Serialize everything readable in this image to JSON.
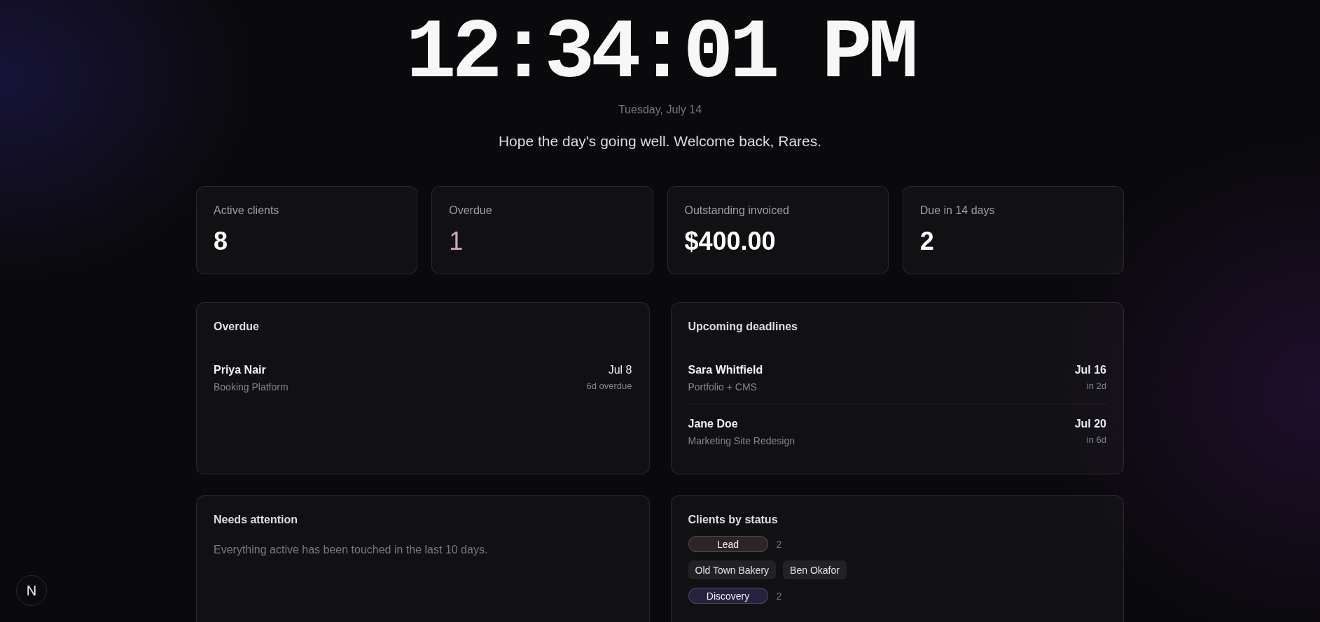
{
  "clock": {
    "time": "12:34:01 PM",
    "date": "Tuesday, July 14",
    "greeting": "Hope the day's going well. Welcome back, Rares."
  },
  "stats": [
    {
      "label": "Active clients",
      "value": "8",
      "alert": false
    },
    {
      "label": "Overdue",
      "value": "1",
      "alert": true
    },
    {
      "label": "Outstanding invoiced",
      "value": "$400.00",
      "alert": false
    },
    {
      "label": "Due in 14 days",
      "value": "2",
      "alert": false
    }
  ],
  "overdue": {
    "title": "Overdue",
    "items": [
      {
        "name": "Priya Nair",
        "project": "Booking Platform",
        "date": "Jul 8",
        "note": "6d overdue"
      }
    ]
  },
  "upcoming": {
    "title": "Upcoming deadlines",
    "items": [
      {
        "name": "Sara Whitfield",
        "project": "Portfolio + CMS",
        "date": "Jul 16",
        "note": "in 2d"
      },
      {
        "name": "Jane Doe",
        "project": "Marketing Site Redesign",
        "date": "Jul 20",
        "note": "in 6d"
      }
    ]
  },
  "needs_attention": {
    "title": "Needs attention",
    "message": "Everything active has been touched in the last 10 days."
  },
  "clients_by_status": {
    "title": "Clients by status",
    "groups": [
      {
        "status": "Lead",
        "color": "#2e2428",
        "count": "2",
        "clients": [
          "Old Town Bakery",
          "Ben Okafor"
        ]
      },
      {
        "status": "Discovery",
        "color": "#25213f",
        "count": "2"
      }
    ]
  },
  "dev_badge": {
    "label": "N"
  }
}
